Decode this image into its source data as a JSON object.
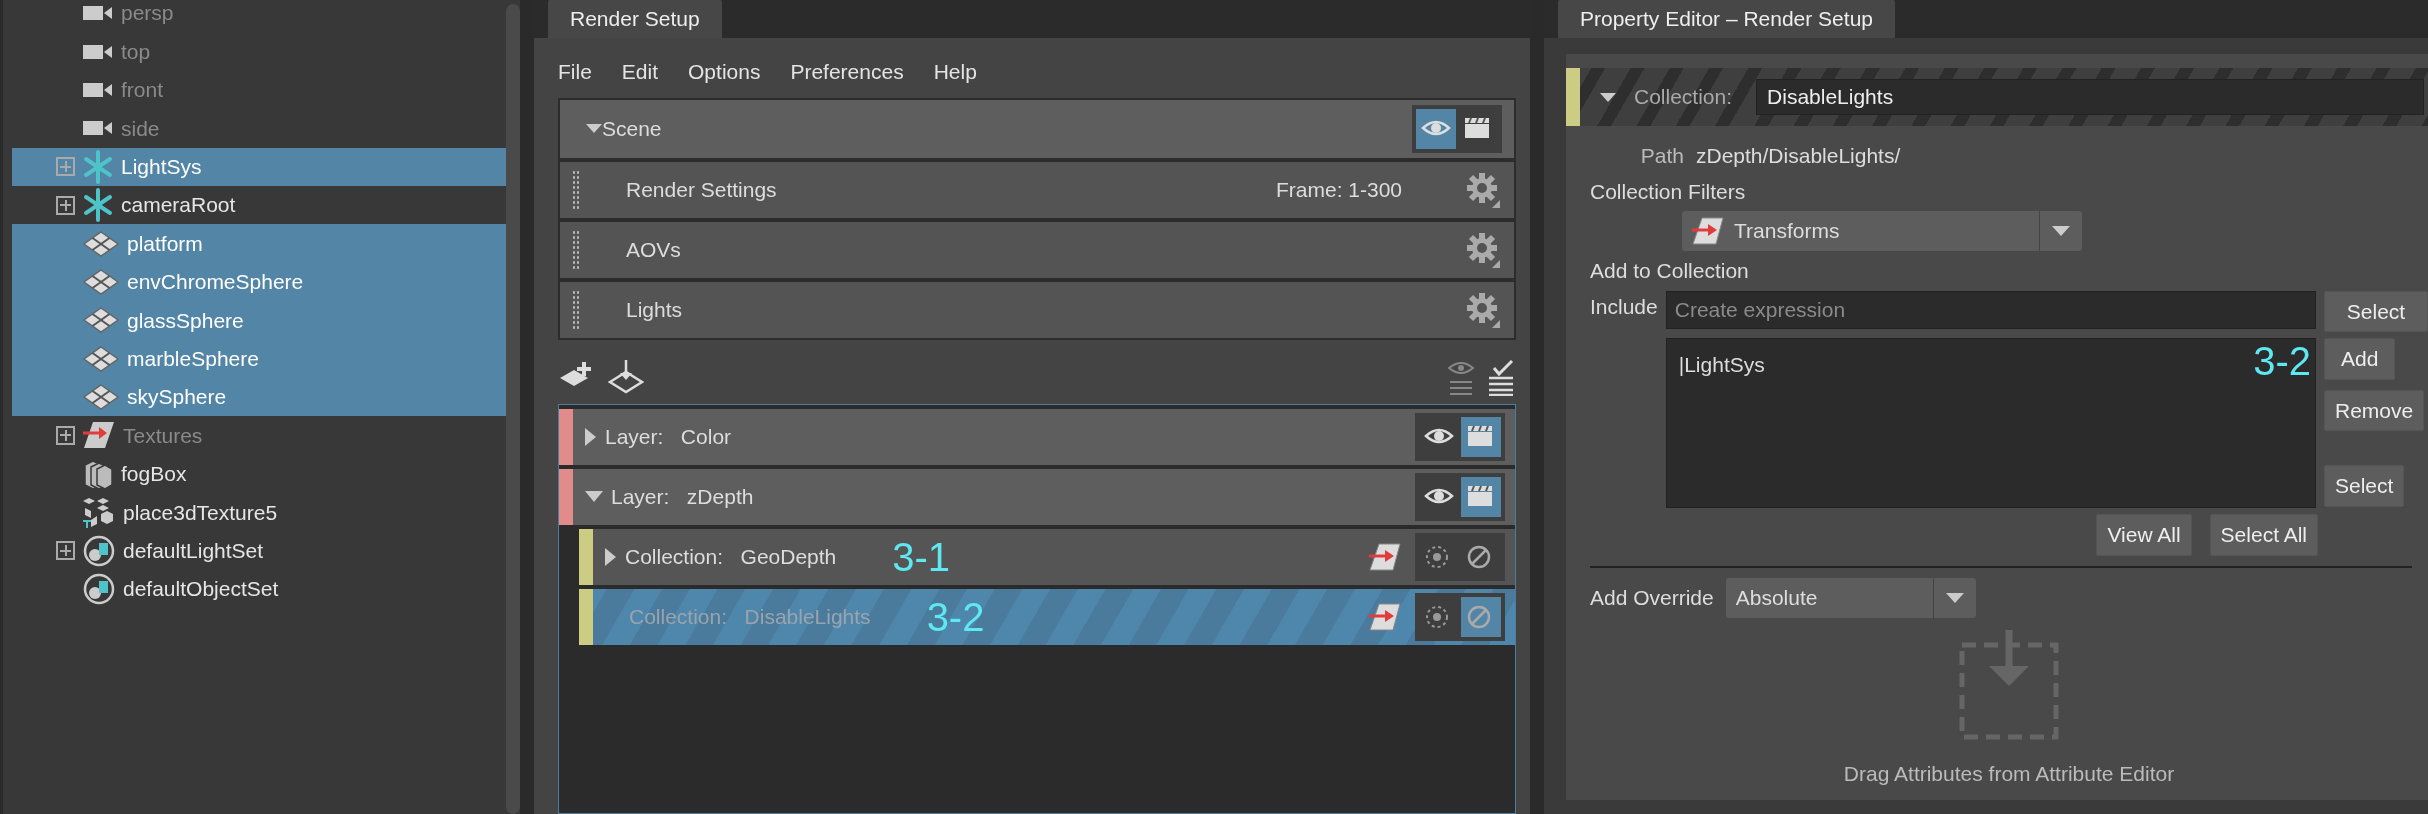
{
  "outliner": {
    "items": [
      {
        "label": "persp",
        "kind": "camera",
        "expandable": false,
        "selected": false,
        "dimmed": true
      },
      {
        "label": "top",
        "kind": "camera",
        "expandable": false,
        "selected": false,
        "dimmed": true
      },
      {
        "label": "front",
        "kind": "camera",
        "expandable": false,
        "selected": false,
        "dimmed": true
      },
      {
        "label": "side",
        "kind": "camera",
        "expandable": false,
        "selected": false,
        "dimmed": true
      },
      {
        "label": "LightSys",
        "kind": "group",
        "expandable": true,
        "selected": true,
        "dimmed": false
      },
      {
        "label": "cameraRoot",
        "kind": "group",
        "expandable": true,
        "selected": false,
        "dimmed": false
      },
      {
        "label": "platform",
        "kind": "mesh",
        "expandable": false,
        "selected": true,
        "dimmed": false
      },
      {
        "label": "envChromeSphere",
        "kind": "mesh",
        "expandable": false,
        "selected": true,
        "dimmed": false
      },
      {
        "label": "glassSphere",
        "kind": "mesh",
        "expandable": false,
        "selected": true,
        "dimmed": false
      },
      {
        "label": "marbleSphere",
        "kind": "mesh",
        "expandable": false,
        "selected": true,
        "dimmed": false
      },
      {
        "label": "skySphere",
        "kind": "mesh",
        "expandable": false,
        "selected": true,
        "dimmed": false
      },
      {
        "label": "Textures",
        "kind": "texture",
        "expandable": true,
        "selected": false,
        "dimmed": true
      },
      {
        "label": "fogBox",
        "kind": "fog",
        "expandable": false,
        "selected": false,
        "dimmed": false
      },
      {
        "label": "place3dTexture5",
        "kind": "place3d",
        "expandable": false,
        "selected": false,
        "dimmed": false
      },
      {
        "label": "defaultLightSet",
        "kind": "set",
        "expandable": true,
        "selected": false,
        "dimmed": false
      },
      {
        "label": "defaultObjectSet",
        "kind": "set",
        "expandable": false,
        "selected": false,
        "dimmed": false
      }
    ]
  },
  "render_setup": {
    "tab": "Render Setup",
    "menu": [
      "File",
      "Edit",
      "Options",
      "Preferences",
      "Help"
    ],
    "scene": {
      "label": "Scene",
      "expanded": true,
      "visible": true,
      "renderable": false,
      "rows": [
        {
          "label": "Render Settings",
          "info": "Frame: 1-300"
        },
        {
          "label": "AOVs"
        },
        {
          "label": "Lights"
        }
      ]
    },
    "layers": [
      {
        "kind": "layer",
        "type_label": "Layer:",
        "name": "Color",
        "expandable": true,
        "expanded": false,
        "visible": false,
        "renderable": true,
        "selected": false,
        "color": "#e28b8b"
      },
      {
        "kind": "layer",
        "type_label": "Layer:",
        "name": "zDepth",
        "expandable": true,
        "expanded": true,
        "visible": false,
        "renderable": true,
        "selected": false,
        "color": "#e28b8b"
      },
      {
        "kind": "collection",
        "type_label": "Collection:",
        "name": "GeoDepth",
        "annotation": "3-1",
        "expandable": true,
        "expanded": false,
        "isolated": false,
        "disabled": false,
        "selected": false,
        "color": "#cccc82"
      },
      {
        "kind": "collection",
        "type_label": "Collection:",
        "name": "DisableLights",
        "annotation": "3-2",
        "expandable": false,
        "isolated": false,
        "disabled": true,
        "selected": true,
        "color": "#cccc82"
      }
    ]
  },
  "property_editor": {
    "tab": "Property Editor – Render Setup",
    "collection_label": "Collection:",
    "collection_name": "DisableLights",
    "expanded": true,
    "path_label": "Path",
    "path": "zDepth/DisableLights/",
    "filters_label": "Collection Filters",
    "filter": "Transforms",
    "add_label": "Add to Collection",
    "include_label": "Include",
    "include_placeholder": "Create expression",
    "members": [
      "|LightSys"
    ],
    "annotation": "3-2",
    "side_buttons": [
      "Select",
      "Add",
      "Remove",
      "Select"
    ],
    "bottom_buttons": [
      "View All",
      "Select All"
    ],
    "override_label": "Add Override",
    "override": "Absolute",
    "drop_hint": "Drag Attributes from Attribute Editor"
  }
}
